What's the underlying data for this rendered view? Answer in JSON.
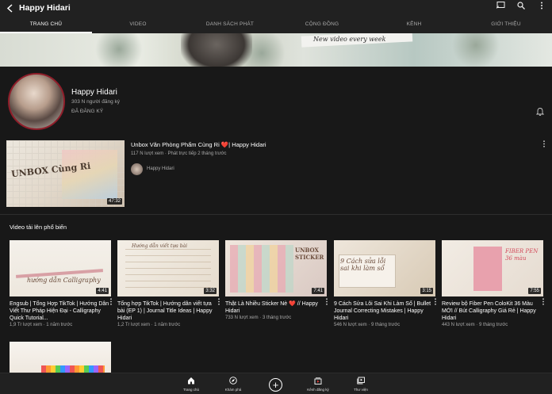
{
  "header": {
    "back_icon": "arrow-left-icon",
    "title": "Happy Hidari",
    "actions": [
      "cast-icon",
      "search-icon",
      "more-vert-icon"
    ]
  },
  "tabs": [
    {
      "label": "TRANG CHỦ",
      "active": true
    },
    {
      "label": "VIDEO",
      "active": false
    },
    {
      "label": "DANH SÁCH PHÁT",
      "active": false
    },
    {
      "label": "CỘNG ĐỒNG",
      "active": false
    },
    {
      "label": "KÊNH",
      "active": false
    },
    {
      "label": "GIỚI THIỆU",
      "active": false
    }
  ],
  "banner": {
    "tagline": "New video every week"
  },
  "channel": {
    "name": "Happy Hidari",
    "subscribers": "303 N người đăng ký",
    "subscribe_state": "ĐÃ ĐĂNG KÝ",
    "bell_icon": "bell-icon"
  },
  "featured": {
    "title": "Unbox Văn Phòng Phẩm Cùng Ri ❤️| Happy Hidari",
    "meta": "117 N lượt xem · Phát trực tiếp 2 tháng trước",
    "channel": "Happy Hidari",
    "duration": "47:32",
    "thumb_text": "UNBOX Cùng Ri"
  },
  "section": {
    "title": "Video tải lên phổ biến"
  },
  "videos": [
    {
      "title": "Engsub | Tổng Hợp TikTok | Hướng Dẫn Viết Thư Pháp Hiện Đại - Calligraphy Quick Tutorial...",
      "meta": "1,9 Tr lượt xem · 1 năm trước",
      "duration": "4:41",
      "thumb_text": "hướng dẫn Calligraphy"
    },
    {
      "title": "Tổng hợp TikTok | Hướng dẫn viết tựa bài (EP 1) | Journal Title Ideas | Happy Hidari",
      "meta": "1,2 Tr lượt xem · 1 năm trước",
      "duration": "3:32",
      "thumb_text": "Hướng dẫn viết tựa bài"
    },
    {
      "title": "Thật Là Nhiều Sticker Nè ❤️ // Happy Hidari",
      "meta": "733 N lượt xem · 3 tháng trước",
      "duration": "7:41",
      "thumb_text": "UNBOX STICKER"
    },
    {
      "title": "9 Cách Sửa Lỗi Sai Khi Làm Sổ | Bullet Journal Correcting Mistakes | Happy Hidari",
      "meta": "546 N lượt xem · 9 tháng trước",
      "duration": "3:15",
      "thumb_text": "9 Cách sửa lỗi sai khi làm sổ"
    },
    {
      "title": "Review bộ Fiber Pen ColoKit 36 Màu MỚI // Bút Calligraphy Giá Rẻ | Happy Hidari",
      "meta": "443 N lượt xem · 9 tháng trước",
      "duration": "7:55",
      "thumb_text": "FIBER PEN 36 màu"
    }
  ],
  "bottom_nav": [
    {
      "label": "Trang chủ",
      "icon": "home-icon"
    },
    {
      "label": "Khám phá",
      "icon": "explore-icon"
    },
    {
      "label": "",
      "icon": "create-icon"
    },
    {
      "label": "Kênh đăng ký",
      "icon": "subscriptions-icon"
    },
    {
      "label": "Thư viện",
      "icon": "library-icon"
    }
  ],
  "colors": {
    "background": "#181818",
    "bar": "#212121",
    "text_secondary": "#aaaaaa",
    "avatar_ring": "#8f1e2a"
  }
}
